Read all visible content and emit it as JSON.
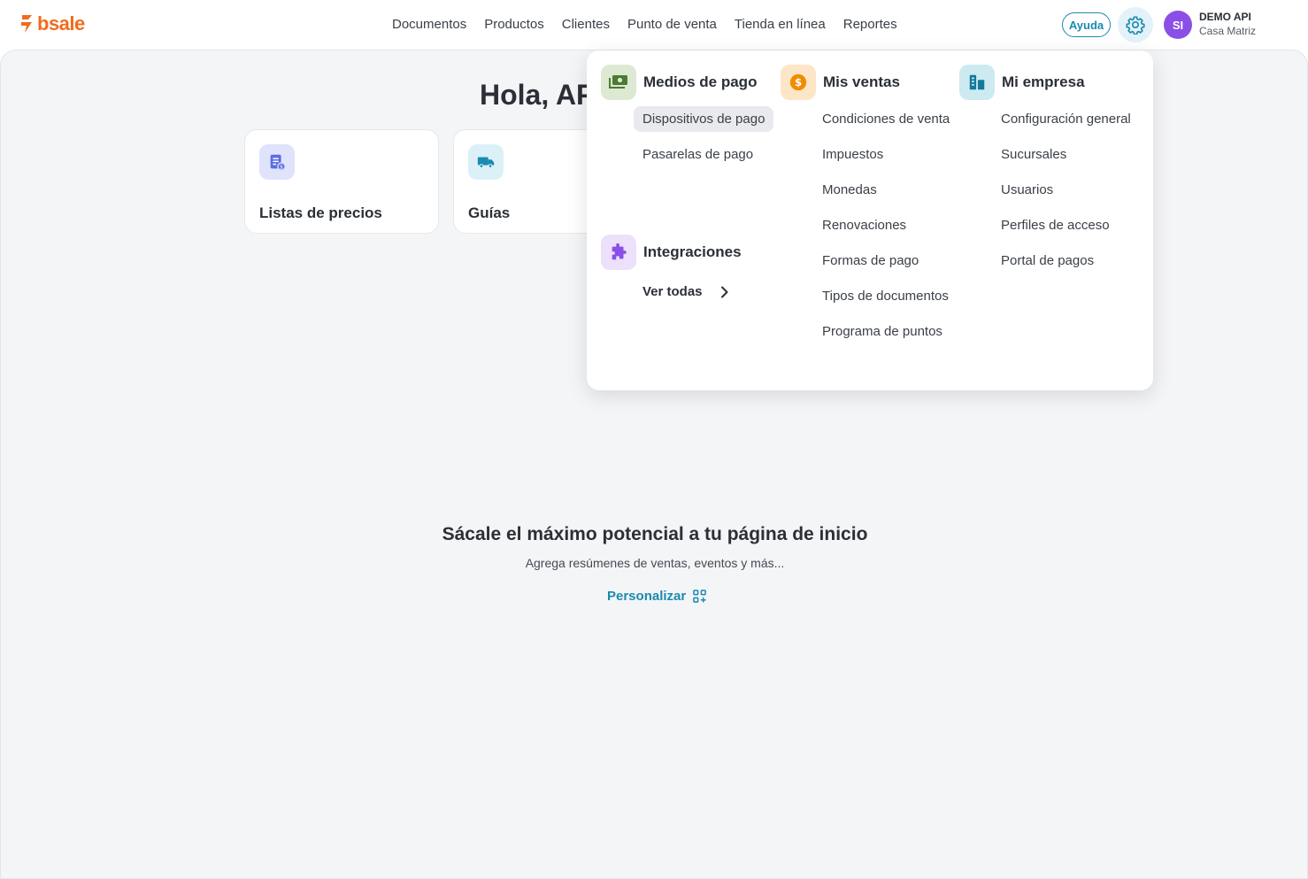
{
  "brand": {
    "name": "bsale",
    "color": "#f26b1d"
  },
  "nav": [
    {
      "label": "Documentos"
    },
    {
      "label": "Productos"
    },
    {
      "label": "Clientes"
    },
    {
      "label": "Punto de venta"
    },
    {
      "label": "Tienda en línea"
    },
    {
      "label": "Reportes"
    }
  ],
  "header": {
    "help_label": "Ayuda",
    "settings_icon": "gear-icon",
    "user": {
      "initials": "SI",
      "name": "DEMO API",
      "branch": "Casa Matriz"
    }
  },
  "home": {
    "greeting": "Hola, AP",
    "cards": [
      {
        "label": "Listas de precios",
        "icon": "price-list-icon"
      },
      {
        "label": "Guías",
        "icon": "truck-icon"
      }
    ],
    "empty_title": "Sácale el máximo potencial a tu página de inicio",
    "empty_subtitle": "Agrega resúmenes de ventas, eventos y más...",
    "personalize_label": "Personalizar"
  },
  "settings_menu": {
    "medios_de_pago": {
      "title": "Medios de pago",
      "icon": "money-icon",
      "items": [
        "Dispositivos de pago",
        "Pasarelas de pago"
      ],
      "active_item": "Dispositivos de pago"
    },
    "integraciones": {
      "title": "Integraciones",
      "icon": "puzzle-icon",
      "see_all_label": "Ver todas"
    },
    "mis_ventas": {
      "title": "Mis ventas",
      "icon": "dollar-coin-icon",
      "items": [
        "Condiciones de venta",
        "Impuestos",
        "Monedas",
        "Renovaciones",
        "Formas de pago",
        "Tipos de documentos",
        "Programa de puntos"
      ]
    },
    "mi_empresa": {
      "title": "Mi empresa",
      "icon": "building-icon",
      "items": [
        "Configuración general",
        "Sucursales",
        "Usuarios",
        "Perfiles de acceso",
        "Portal de pagos"
      ]
    }
  },
  "colors": {
    "accent": "#1a8ab0",
    "avatar": "#8a4fe6",
    "page_bg": "#f4f5f7"
  }
}
